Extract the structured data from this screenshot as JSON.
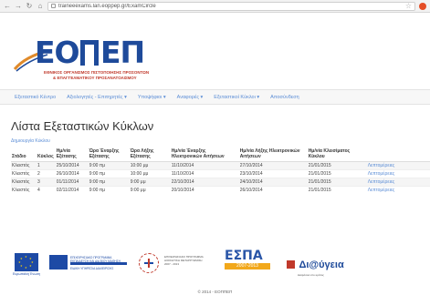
{
  "browser": {
    "url": "traineeexams.lan.eoppep.gr/ExamCircle"
  },
  "logo": {
    "text_left": "ΕΟ",
    "text_right": "ΕΠ",
    "line1": "ΕΘΝΙΚΟΣ ΟΡΓΑΝΙΣΜΟΣ ΠΙΣΤΟΠΟΙΗΣΗΣ ΠΡΟΣΟΝΤΩΝ",
    "line2": "& ΕΠΑΓΓΕΛΜΑΤΙΚΟΥ ΠΡΟΣΑΝΑΤΟΛΙΣΜΟΥ"
  },
  "nav": {
    "items": [
      "Εξεταστικό Κέντρο",
      "Αξιολογητές - Επιτηρητές ▾",
      "Υποψήφιοι ▾",
      "Αναφορές ▾",
      "Εξεταστικοί Κύκλοι ▾",
      "Αποσύνδεση"
    ]
  },
  "main": {
    "title": "Λίστα Εξεταστικών Κύκλων",
    "breadcrumb": "Δημιουργία Κύκλου"
  },
  "table": {
    "headers": [
      "Στάδιο",
      "Κύκλος",
      "Ημ/νία Εξέτασης",
      "Ώρα Έναρξης Εξέτασης",
      "Ώρα Λήξης Εξέτασης",
      "Ημ/νία Έναρξης Ηλεκτρονικών Αιτήσεων",
      "Ημ/νία Λήξης Ηλεκτρονικών Αιτήσεων",
      "Ημ/νία Κλεισίματος Κύκλου",
      ""
    ],
    "rows": [
      [
        "Κλειστός",
        "1",
        "25/10/2014",
        "9:00 πμ",
        "10:00 μμ",
        "11/10/2014",
        "27/10/2014",
        "21/01/2015",
        "Λεπτομέρειες"
      ],
      [
        "Κλειστός",
        "2",
        "26/10/2014",
        "9:00 πμ",
        "10:00 μμ",
        "11/10/2014",
        "23/10/2014",
        "21/01/2015",
        "Λεπτομέρειες"
      ],
      [
        "Κλειστός",
        "3",
        "01/11/2014",
        "9:00 πμ",
        "9:00 μμ",
        "22/10/2014",
        "24/10/2014",
        "21/01/2015",
        "Λεπτομέρειες"
      ],
      [
        "Κλειστός",
        "4",
        "02/11/2014",
        "9:00 πμ",
        "9:00 μμ",
        "20/10/2014",
        "26/10/2014",
        "21/01/2015",
        "Λεπτομέρειες"
      ]
    ]
  },
  "footer": {
    "eu_caption": "Ευρωπαϊκή Ένωση",
    "espa1_lines": [
      "ΕΠΙΧΕΙΡΗΣΙΑΚΟ ΠΡΟΓΡΑΜΜΑ",
      "ΕΚΠΑΙΔΕΥΣΗ ΚΑΙ ΔΙΑ ΒΙΟΥ ΜΑΘΗΣΗ",
      "ΕΙΔΙΚΗ ΥΠΗΡΕΣΙΑ ΔΙΑΧΕΙΡΙΣΗΣ"
    ],
    "prog_lines": [
      "ΕΠΙΧΕΙΡΗΣΙΑΚΟ ΠΡΟΓΡΑΜΜΑ",
      "ΔΙΟΙΚΗΤΙΚΗ ΜΕΤΑΡΡΥΘΜΙΣΗ",
      "2007 - 2013"
    ],
    "espa_word": "ΕΣΠΑ",
    "espa_years": "2007-2013",
    "diaugeia_word": "Δι@ύγεια",
    "diaugeia_caption": "Διαφάνεια στο κράτος",
    "copyright": "© 2014 - ΕΟΠΠΕΠ"
  }
}
